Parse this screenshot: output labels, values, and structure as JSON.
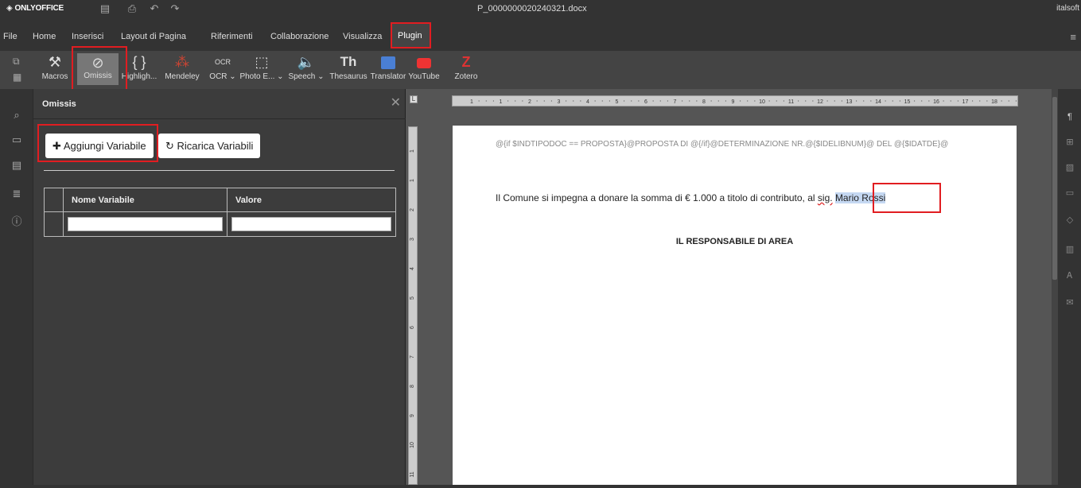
{
  "app": {
    "logo_text": "ONLYOFFICE",
    "doc_title": "P_0000000020240321.docx",
    "user": "italsoft"
  },
  "menu": {
    "file": "File",
    "home": "Home",
    "inserisci": "Inserisci",
    "layout": "Layout di Pagina",
    "riferimenti": "Riferimenti",
    "collaborazione": "Collaborazione",
    "visualizza": "Visualizza",
    "plugin": "Plugin"
  },
  "toolbar": {
    "macros": "Macros",
    "omissis": "Omissis",
    "highlight": "Highligh...",
    "mendeley": "Mendeley",
    "ocr": "OCR",
    "photo": "Photo E...",
    "speech": "Speech",
    "thesaurus": "Thesaurus",
    "translator": "Translator",
    "youtube": "YouTube",
    "zotero": "Zotero",
    "thesaurus_icon_text": "Th",
    "zotero_icon_text": "Z",
    "ocr_icon_text": "OCR"
  },
  "panel": {
    "title": "Omissis",
    "add_button": "Aggiungi Variabile",
    "reload_button": "Ricarica Variabili",
    "col_name": "Nome Variabile",
    "col_value": "Valore",
    "name_value": "",
    "value_value": ""
  },
  "document": {
    "field_line": "@{if $INDTIPODOC == PROPOSTA}@PROPOSTA DI @{/if}@DETERMINAZIONE NR.@{$IDELIBNUM}@ DEL @{$IDATDE}@",
    "para_before": "Il Comune si impegna a donare la somma di € 1.000 a titolo di contributo, al ",
    "para_sig": "sig.",
    "para_selected": "Mario Rossi",
    "heading": "IL RESPONSABILE DI AREA"
  },
  "ruler_labels": [
    "1",
    "1",
    "2",
    "3",
    "4",
    "5",
    "6",
    "7",
    "8",
    "9",
    "10",
    "11",
    "12",
    "13",
    "14",
    "15",
    "16",
    "17",
    "18"
  ],
  "vruler_labels": [
    "1",
    "1",
    "2",
    "3",
    "4",
    "5",
    "6",
    "7",
    "8",
    "9",
    "10",
    "11"
  ],
  "colors": {
    "highlight_red": "#e11d21",
    "mendeley_red": "#c43",
    "youtube_red": "#e33",
    "zotero_red": "#d33",
    "translator_blue": "#4a7fd4"
  }
}
